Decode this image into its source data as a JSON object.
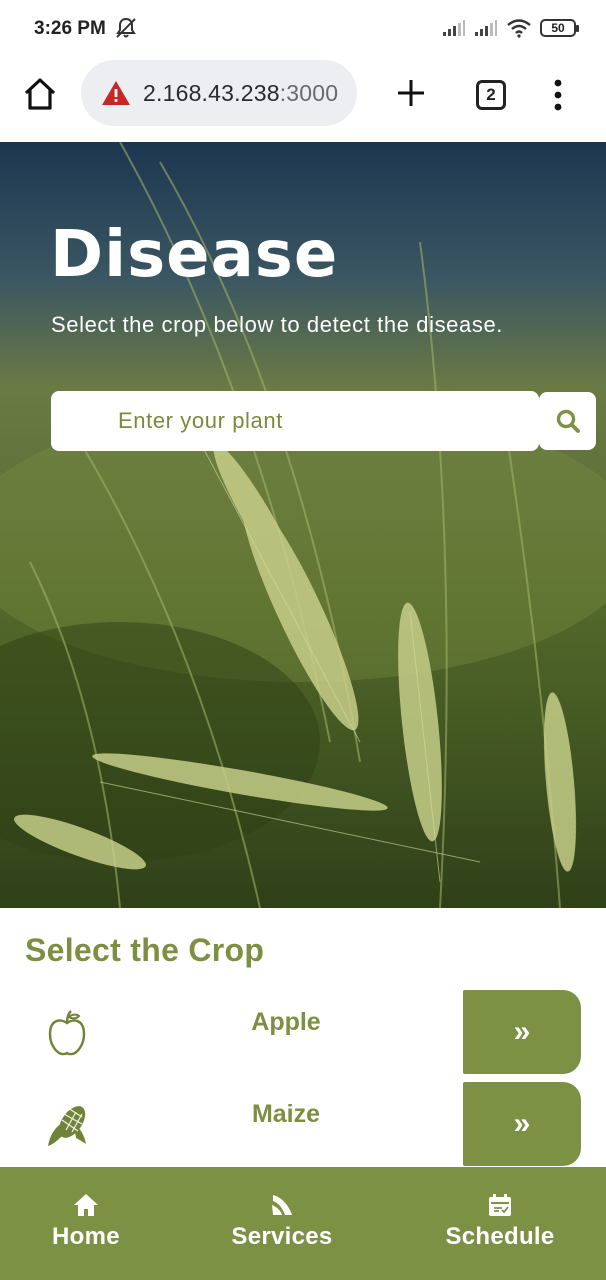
{
  "status_bar": {
    "time": "3:26 PM",
    "battery": "50"
  },
  "browser": {
    "url_host": "2.168.43.238",
    "url_port": ":3000",
    "tab_count": "2"
  },
  "hero": {
    "title": "Disease",
    "subtitle": "Select the crop below to detect the disease.",
    "search_placeholder": "Enter your plant"
  },
  "crops": {
    "section_title": "Select the Crop",
    "items": [
      {
        "name": "Apple",
        "icon": "apple-icon",
        "action": "»"
      },
      {
        "name": "Maize",
        "icon": "maize-icon",
        "action": "»"
      }
    ]
  },
  "bottom_nav": {
    "items": [
      {
        "label": "Home",
        "icon": "home-icon"
      },
      {
        "label": "Services",
        "icon": "services-icon"
      },
      {
        "label": "Schedule",
        "icon": "schedule-icon"
      }
    ]
  },
  "colors": {
    "accent": "#7d9145",
    "accent_text": "#7d8f41",
    "warning": "#c62828"
  }
}
